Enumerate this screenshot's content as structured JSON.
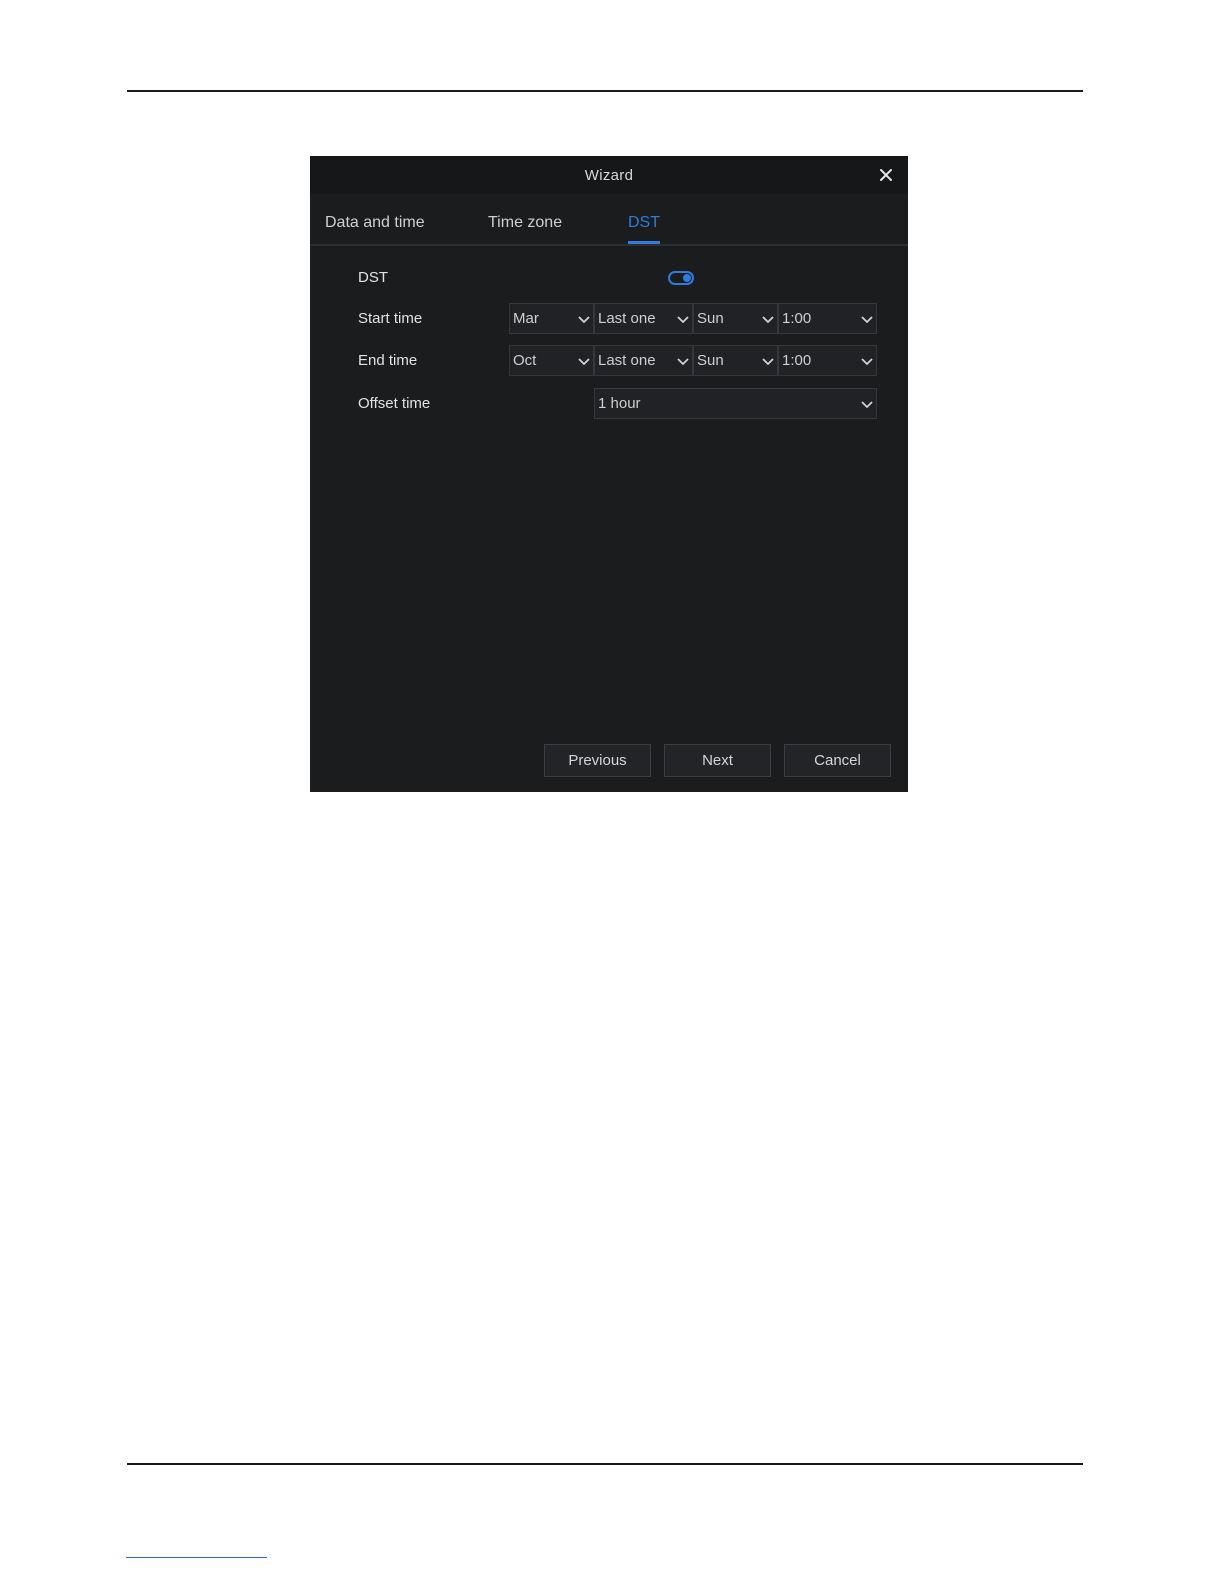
{
  "dialog": {
    "title": "Wizard",
    "tabs": [
      {
        "label": "Data and time",
        "active": false
      },
      {
        "label": "Time zone",
        "active": false
      },
      {
        "label": "DST",
        "active": true
      }
    ],
    "dst": {
      "label": "DST",
      "enabled": true
    },
    "start_time": {
      "label": "Start time",
      "month": "Mar",
      "week": "Last one",
      "day": "Sun",
      "time": "1:00"
    },
    "end_time": {
      "label": "End time",
      "month": "Oct",
      "week": "Last one",
      "day": "Sun",
      "time": "1:00"
    },
    "offset_time": {
      "label": "Offset time",
      "value": "1 hour"
    },
    "buttons": {
      "previous": "Previous",
      "next": "Next",
      "cancel": "Cancel"
    }
  },
  "colors": {
    "accent": "#2f7be0",
    "dialog_bg": "#1b1c1e",
    "titlebar_bg": "#161718"
  },
  "icons": {
    "close": "close-icon",
    "dropdown": "chevron-down-icon"
  }
}
